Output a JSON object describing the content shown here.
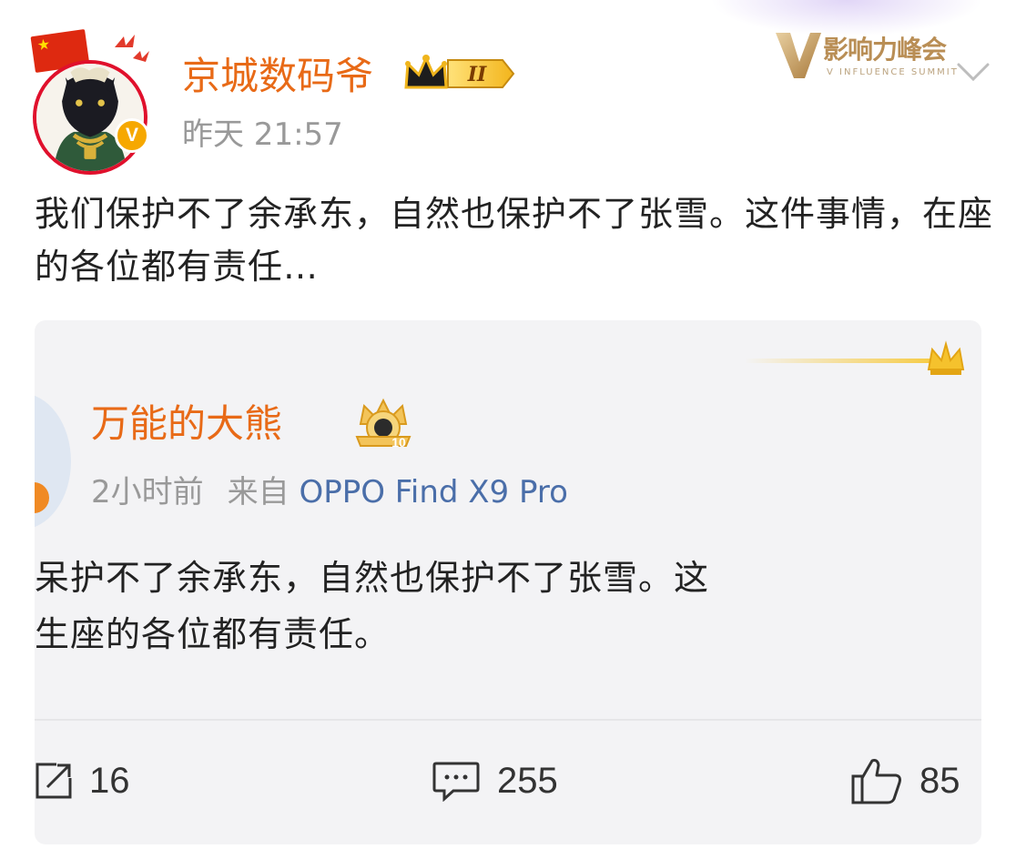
{
  "post": {
    "author": {
      "name": "京城数码爷",
      "avatar_icon": "panther-avatar-icon",
      "verified_label": "V",
      "rank_label": "II"
    },
    "time": "昨天 21:57",
    "text": "我们保护不了余承东，自然也保护不了张雪。这件事情，在座的各位都有责任…",
    "event_logo": {
      "title": "影响力峰会",
      "subtitle": "V INFLUENCE SUMMIT"
    }
  },
  "quoted": {
    "author": {
      "name": "万能的大熊",
      "vip_level": "10"
    },
    "time": "2小时前",
    "source_prefix": "来自",
    "source_device": "OPPO Find X9 Pro",
    "text_line1": "呆护不了余承东，自然也保护不了张雪。这",
    "text_line2": "生座的各位都有责任。",
    "actions": {
      "reposts": "16",
      "comments": "255",
      "likes": "85"
    }
  },
  "colors": {
    "username": "#e86a17",
    "meta": "#999999",
    "source_link": "#4a6ea9",
    "card_background": "#f3f3f5",
    "verified": "#f6a800"
  }
}
